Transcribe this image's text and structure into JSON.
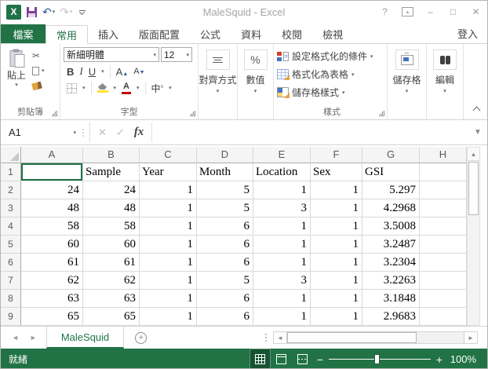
{
  "colors": {
    "excel_green": "#217346",
    "save_purple": "#7d3f98",
    "undo_blue": "#2b579a",
    "fill_yellow": "#ffe333",
    "font_red": "#c00000",
    "grid_line": "#d9d9d9"
  },
  "title_bar": {
    "title": "MaleSquid - Excel",
    "help": "?",
    "minimize": "–",
    "maximize": "□",
    "close": "✕",
    "undo": "↶",
    "redo": "↷"
  },
  "tabs": {
    "file": "檔案",
    "items": [
      "常用",
      "插入",
      "版面配置",
      "公式",
      "資料",
      "校閱",
      "檢視"
    ],
    "active_index": 0,
    "sign_in": "登入"
  },
  "ribbon": {
    "clipboard": {
      "paste": "貼上",
      "label": "剪貼簿",
      "cut": "✂"
    },
    "font": {
      "name": "新細明體",
      "size": "12",
      "bold": "B",
      "italic": "I",
      "underline": "U",
      "grow": "A",
      "shrink": "A",
      "phonetic": "中",
      "label": "字型"
    },
    "alignment": {
      "label": "對齊方式"
    },
    "number": {
      "symbol": "%",
      "label": "數值"
    },
    "styles": {
      "conditional": "設定格式化的條件",
      "format_table": "格式化為表格",
      "cell_styles": "儲存格樣式",
      "label": "樣式"
    },
    "cells": {
      "label": "儲存格"
    },
    "editing": {
      "label": "編輯"
    }
  },
  "formula_bar": {
    "name_box": "A1",
    "cancel": "✕",
    "enter": "✓",
    "fx": "fx",
    "value": ""
  },
  "grid": {
    "columns": [
      "A",
      "B",
      "C",
      "D",
      "E",
      "F",
      "G",
      "H"
    ],
    "rows": [
      {
        "n": "1",
        "cells": [
          "",
          "Sample",
          "Year",
          "Month",
          "Location",
          "Sex",
          "GSI",
          ""
        ]
      },
      {
        "n": "2",
        "cells": [
          "24",
          "24",
          "1",
          "5",
          "1",
          "1",
          "5.297",
          ""
        ]
      },
      {
        "n": "3",
        "cells": [
          "48",
          "48",
          "1",
          "5",
          "3",
          "1",
          "4.2968",
          ""
        ]
      },
      {
        "n": "4",
        "cells": [
          "58",
          "58",
          "1",
          "6",
          "1",
          "1",
          "3.5008",
          ""
        ]
      },
      {
        "n": "5",
        "cells": [
          "60",
          "60",
          "1",
          "6",
          "1",
          "1",
          "3.2487",
          ""
        ]
      },
      {
        "n": "6",
        "cells": [
          "61",
          "61",
          "1",
          "6",
          "1",
          "1",
          "3.2304",
          ""
        ]
      },
      {
        "n": "7",
        "cells": [
          "62",
          "62",
          "1",
          "5",
          "3",
          "1",
          "3.2263",
          ""
        ]
      },
      {
        "n": "8",
        "cells": [
          "63",
          "63",
          "1",
          "6",
          "1",
          "1",
          "3.1848",
          ""
        ]
      },
      {
        "n": "9",
        "cells": [
          "65",
          "65",
          "1",
          "6",
          "1",
          "1",
          "2.9683",
          ""
        ]
      }
    ],
    "active_cell": "A1"
  },
  "sheet_bar": {
    "sheet": "MaleSquid",
    "new_sheet": "+"
  },
  "status_bar": {
    "ready": "就緒",
    "zoom_level": "100%",
    "zoom_out": "−",
    "zoom_in": "+"
  }
}
